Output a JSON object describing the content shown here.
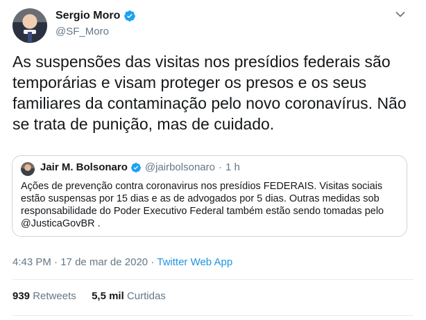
{
  "author": {
    "name": "Sergio Moro",
    "handle": "@SF_Moro"
  },
  "tweet": {
    "text": "As suspensões das visitas nos presídios federais são temporárias e visam proteger os presos e os seus familiares da contaminação pelo novo coronavírus. Não se trata de punição, mas de cuidado.",
    "time": "4:43 PM",
    "meta_sep": "·",
    "date": "17 de mar de 2020",
    "app": "Twitter Web App"
  },
  "quoted": {
    "name": "Jair M. Bolsonaro",
    "handle": "@jairbolsonaro",
    "sep": "·",
    "time": "1 h",
    "text": "Ações de prevenção contra coronavirus nos presídios FEDERAIS. Visitas sociais estão suspensas por 15 dias e as de advogados por 5 dias. Outras medidas sob responsabilidade do Poder Executivo Federal também estão sendo tomadas pelo @JusticaGovBR ."
  },
  "stats": {
    "retweets_count": "939",
    "retweets_label": "Retweets",
    "likes_count": "5,5 mil",
    "likes_label": "Curtidas"
  },
  "icons": {
    "verified": "verified-badge-icon",
    "more": "chevron-down-icon"
  },
  "colors": {
    "accent": "#1da1f2",
    "link": "#1b95e0",
    "muted": "#657786",
    "border": "#ccd6dd"
  }
}
